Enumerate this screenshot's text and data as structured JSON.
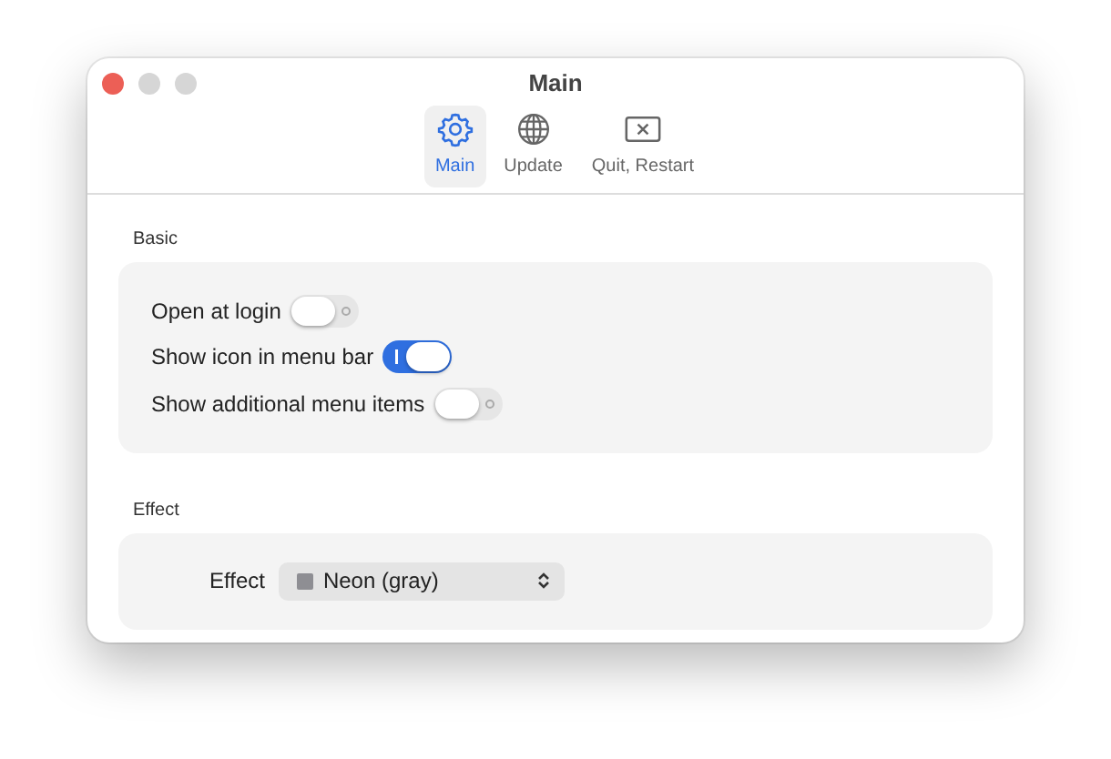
{
  "window": {
    "title": "Main"
  },
  "tabs": [
    {
      "label": "Main",
      "selected": true
    },
    {
      "label": "Update",
      "selected": false
    },
    {
      "label": "Quit, Restart",
      "selected": false
    }
  ],
  "sections": [
    {
      "title": "Basic",
      "items": [
        {
          "kind": "toggle",
          "label": "Open at login",
          "on": false
        },
        {
          "kind": "toggle",
          "label": "Show icon in menu bar",
          "on": true
        },
        {
          "kind": "toggle",
          "label": "Show additional menu items",
          "on": false
        }
      ]
    },
    {
      "title": "Effect",
      "items": [
        {
          "kind": "popup",
          "label": "Effect",
          "value": "Neon (gray)",
          "color": "#8e8e93"
        }
      ]
    }
  ]
}
